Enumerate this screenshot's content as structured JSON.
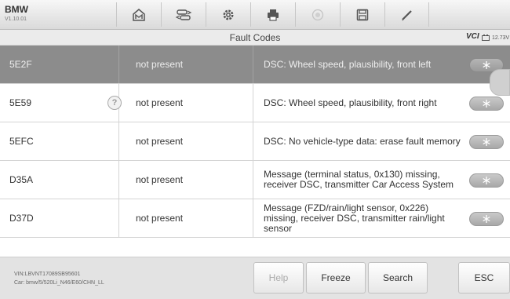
{
  "brand": {
    "name": "BMW",
    "version": "V1.10.01"
  },
  "toolbar": {
    "icons": [
      "home-icon",
      "vehicle-swap-icon",
      "settings-icon",
      "print-icon",
      "help-icon",
      "save-icon",
      "edit-icon"
    ]
  },
  "header": {
    "title": "Fault Codes",
    "vci_label": "VCI",
    "battery_voltage": "12.73V"
  },
  "fault_codes": [
    {
      "code": "5E2F",
      "status": "not present",
      "description": "DSC: Wheel speed, plausibility, front left",
      "selected": true,
      "has_help": false
    },
    {
      "code": "5E59",
      "status": "not present",
      "description": "DSC: Wheel speed, plausibility, front right",
      "selected": false,
      "has_help": true
    },
    {
      "code": "5EFC",
      "status": "not present",
      "description": "DSC: No vehicle-type data: erase fault memory",
      "selected": false,
      "has_help": false
    },
    {
      "code": "D35A",
      "status": "not present",
      "description": "Message (terminal status, 0x130) missing, receiver DSC, transmitter Car Access System",
      "selected": false,
      "has_help": false
    },
    {
      "code": "D37D",
      "status": "not present",
      "description": "Message (FZD/rain/light sensor, 0x226) missing, receiver DSC, transmitter rain/light sensor",
      "selected": false,
      "has_help": false
    }
  ],
  "help_symbol": "?",
  "vehicle": {
    "vin": "VIN:LBVNT17089SB95601",
    "car": "Car: bmw/5/520Li_N46/E60/CHN_LL"
  },
  "buttons": {
    "help": "Help",
    "freeze": "Freeze",
    "search": "Search",
    "esc": "ESC"
  }
}
